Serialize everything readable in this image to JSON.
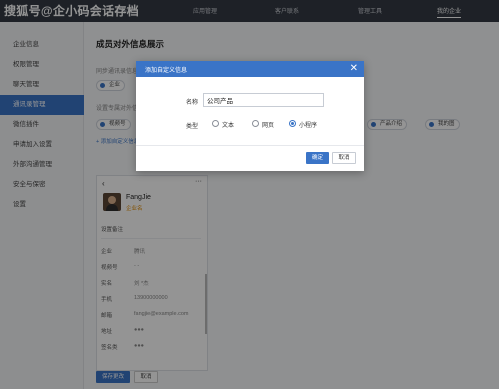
{
  "watermark": "搜狐号@企小码会话存档",
  "nav": {
    "tabs": [
      "工作台",
      "应用管理",
      "客户联系",
      "管理工具",
      "我的企业"
    ],
    "active_index": 4
  },
  "sidebar": {
    "items": [
      "企业信息",
      "权限管理",
      "聊天管理",
      "通讯录管理",
      "微信插件",
      "申请加入设置",
      "外部沟通管理",
      "安全与保密",
      "设置"
    ],
    "active_index": 3
  },
  "main": {
    "title": "成员对外信息展示",
    "sync_label": "同步通讯录信息",
    "sync_chip": "企业",
    "custom_label": "设置专属对外信息",
    "chips": [
      "视频号",
      "产品介绍",
      "我的图"
    ],
    "add_link": "添加自定义信息",
    "save_button": "保存更改",
    "cancel_button": "取消"
  },
  "preview": {
    "back": "‹",
    "more": "···",
    "name": "FangJie",
    "subtitle": "企业名",
    "section": "设置备注",
    "rows": [
      {
        "key": "企业",
        "value": "腾讯"
      },
      {
        "key": "视频号",
        "value": "- -"
      },
      {
        "key": "实名",
        "value": "刘 *杰"
      },
      {
        "key": "手机",
        "value": "13900000000"
      },
      {
        "key": "邮箱",
        "value": "fangjie@example.com"
      },
      {
        "key": "地址",
        "value": "●●●"
      },
      {
        "key": "签名类",
        "value": "●●●"
      }
    ]
  },
  "modal": {
    "title": "添加自定义信息",
    "close": "✕",
    "name_label": "名称",
    "name_value": "公司产品",
    "type_label": "类型",
    "options": [
      "文本",
      "网页",
      "小程序"
    ],
    "selected_index": 2,
    "ok": "确定",
    "cancel": "取消"
  },
  "colors": {
    "accent": "#3a74c7",
    "nav_bg": "#343a44",
    "overlay": "rgba(0,0,0,0.42)"
  }
}
